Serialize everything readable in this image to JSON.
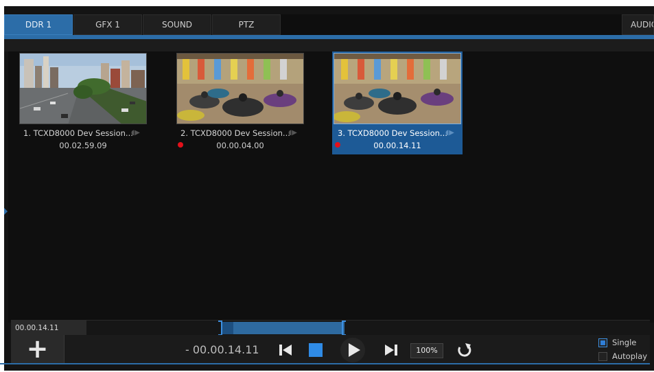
{
  "tabs": [
    {
      "label": "DDR 1",
      "active": true
    },
    {
      "label": "GFX 1",
      "active": false
    },
    {
      "label": "SOUND",
      "active": false
    },
    {
      "label": "PTZ",
      "active": false
    },
    {
      "label": "AUDIO",
      "active": false
    }
  ],
  "playlist": [
    {
      "title": "1. TCXD8000 Dev Session...",
      "duration": "00.02.59.09",
      "selected": false,
      "red_dot": false
    },
    {
      "title": "2. TCXD8000 Dev Session...",
      "duration": "00.00.04.00",
      "selected": false,
      "red_dot": true
    },
    {
      "title": "3. TCXD8000 Dev Session...",
      "duration": "00.00.14.11",
      "selected": true,
      "red_dot": true
    }
  ],
  "scrub": {
    "time": "00.00.14.11"
  },
  "transport": {
    "add_label": "+",
    "remaining_time": "- 00.00.14.11",
    "speed": "100%"
  },
  "options": {
    "single_label": "Single",
    "single_checked": true,
    "autoplay_label": "Autoplay",
    "autoplay_checked": false
  },
  "icons": {
    "add": "plus-icon",
    "skip_back": "skip-back-icon",
    "stop": "stop-icon",
    "play": "play-icon",
    "skip_forward": "skip-forward-icon",
    "loop": "loop-icon",
    "audio": "speaker-icon"
  },
  "colors": {
    "accent": "#2c6da8",
    "selected": "#1d5a96",
    "record_dot": "#e3101a",
    "stop": "#2f8be6"
  }
}
